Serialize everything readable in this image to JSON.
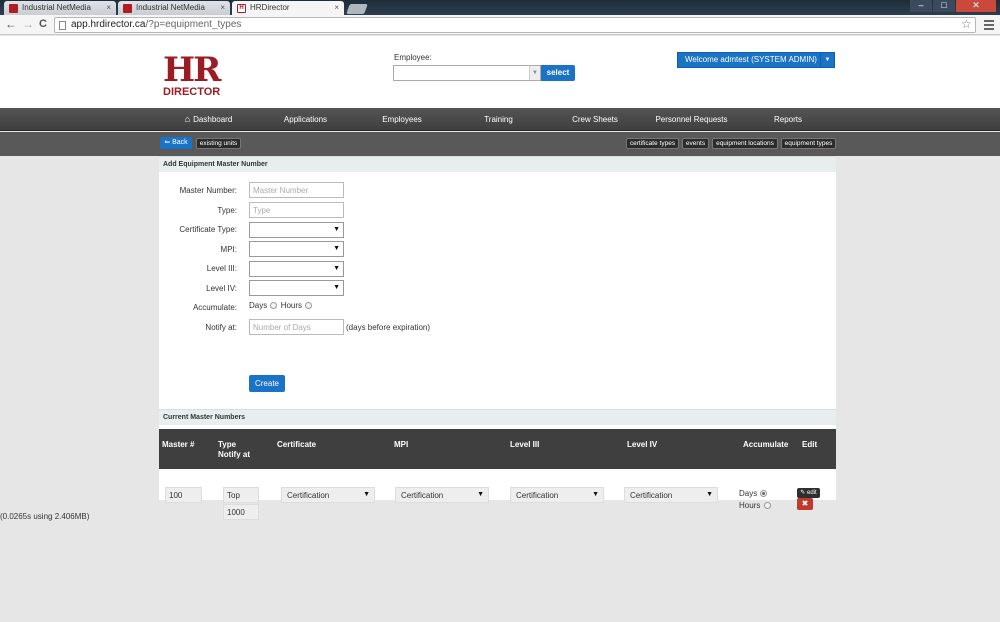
{
  "browser": {
    "tabs": [
      {
        "title": "Industrial NetMedia",
        "close": "×"
      },
      {
        "title": "Industrial NetMedia",
        "close": "×"
      },
      {
        "title": "HRDirector",
        "close": "×"
      }
    ],
    "window_controls": {
      "minimize": "–",
      "maximize": "□",
      "close": "✕"
    },
    "nav": {
      "back": "←",
      "forward": "→",
      "reload": "C"
    },
    "url_host": "app.hrdirector.ca",
    "url_path": "/?p=equipment_types",
    "star": "☆"
  },
  "header": {
    "logo_top": "HR",
    "logo_bottom": "DIRECTOR",
    "employee_label": "Employee:",
    "employee_value": "",
    "select_button": "select",
    "welcome": "Welcome admtest (SYSTEM ADMIN)"
  },
  "nav": {
    "items": [
      "Dashboard",
      "Applications",
      "Employees",
      "Training",
      "Crew Sheets",
      "Personnel Requests",
      "Reports"
    ]
  },
  "subnav": {
    "back": "Back",
    "existing_units": "existing units",
    "right_buttons": [
      "certificate types",
      "events",
      "equipment locations",
      "equipment types"
    ]
  },
  "form": {
    "section_title": "Add Equipment Master Number",
    "master_number_label": "Master Number:",
    "master_number_placeholder": "Master Number",
    "type_label": "Type:",
    "type_placeholder": "Type",
    "certificate_type_label": "Certificate Type:",
    "mpi_label": "MPI:",
    "level3_label": "Level III:",
    "level4_label": "Level IV:",
    "accumulate_label": "Accumulate:",
    "days_option": "Days",
    "hours_option": "Hours",
    "notify_label": "Notify at:",
    "notify_placeholder": "Number of Days",
    "notify_suffix": "(days before expiration)",
    "create_button": "Create"
  },
  "table": {
    "section_title": "Current Master Numbers",
    "headers": {
      "master": "Master #",
      "type": "Type",
      "notify": "Notify at",
      "certificate": "Certificate",
      "mpi": "MPI",
      "level3": "Level III",
      "level4": "Level IV",
      "accumulate": "Accumulate",
      "edit": "Edit"
    },
    "rows": [
      {
        "master": "100",
        "type": "Top",
        "notify": "1000",
        "certificate": "Certification",
        "mpi": "Certification",
        "level3": "Certification",
        "level4": "Certification",
        "days": "Days",
        "hours": "Hours",
        "accumulate_selected": "Days",
        "edit_label": "edit",
        "delete_label": "✖"
      }
    ]
  },
  "footer": {
    "timing": "(0.0265s using 2.406MB)"
  },
  "colors": {
    "accent": "#1a73c6",
    "brand": "#9b1c24",
    "nav_bg": "#444444"
  }
}
